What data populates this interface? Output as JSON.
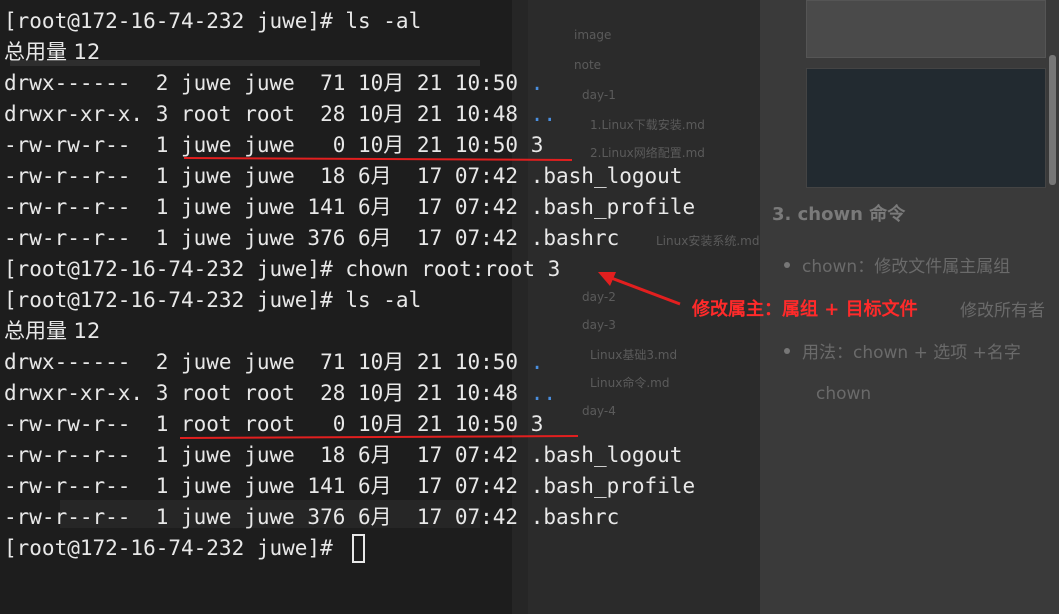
{
  "terminal": {
    "lines": [
      {
        "text": "[root@172-16-74-232 juwe]# ls -al"
      },
      {
        "text": "总用量 12"
      },
      {
        "text": "drwx------  2 juwe juwe  71 10月 21 10:50 ",
        "name": "."
      },
      {
        "text": "drwxr-xr-x. 3 root root  28 10月 21 10:48 ",
        "name": ".."
      },
      {
        "text": "-rw-rw-r--  1 juwe juwe   0 10月 21 10:50 3"
      },
      {
        "text": "-rw-r--r--  1 juwe juwe  18 6月  17 07:42 .bash_logout"
      },
      {
        "text": "-rw-r--r--  1 juwe juwe 141 6月  17 07:42 .bash_profile"
      },
      {
        "text": "-rw-r--r--  1 juwe juwe 376 6月  17 07:42 .bashrc"
      },
      {
        "text": "[root@172-16-74-232 juwe]# chown root:root 3"
      },
      {
        "text": "[root@172-16-74-232 juwe]# ls -al"
      },
      {
        "text": "总用量 12"
      },
      {
        "text": "drwx------  2 juwe juwe  71 10月 21 10:50 ",
        "name": "."
      },
      {
        "text": "drwxr-xr-x. 3 root root  28 10月 21 10:48 ",
        "name": ".."
      },
      {
        "text": "-rw-rw-r--  1 root root   0 10月 21 10:50 3"
      },
      {
        "text": "-rw-r--r--  1 juwe juwe  18 6月  17 07:42 .bash_logout"
      },
      {
        "text": "-rw-r--r--  1 juwe juwe 141 6月  17 07:42 .bash_profile"
      },
      {
        "text": "-rw-r--r--  1 juwe juwe 376 6月  17 07:42 .bashrc"
      },
      {
        "text": "[root@172-16-74-232 juwe]# "
      }
    ]
  },
  "annotation": {
    "label": "修改属主：属组 + 目标文件",
    "color": "#e21f1f"
  },
  "background_doc": {
    "heading": "3. chown 命令",
    "items": [
      "chown：修改文件属主属组",
      "修改所有者",
      "用法：chown + 选项 +名字",
      "chown"
    ]
  },
  "background_tree": {
    "items": [
      "image",
      "note",
      "day-1",
      "1.Linux下载安装.md",
      "2.Linux网络配置.md",
      "Linux安装系统.md",
      "day-2",
      "day-3",
      "Linux基础3.md",
      "Linux命令.md",
      "day-4"
    ]
  },
  "colors": {
    "terminal_text": "#e8e8e8",
    "directory": "#4a8fe0",
    "highlight_red": "#e21f1f"
  }
}
